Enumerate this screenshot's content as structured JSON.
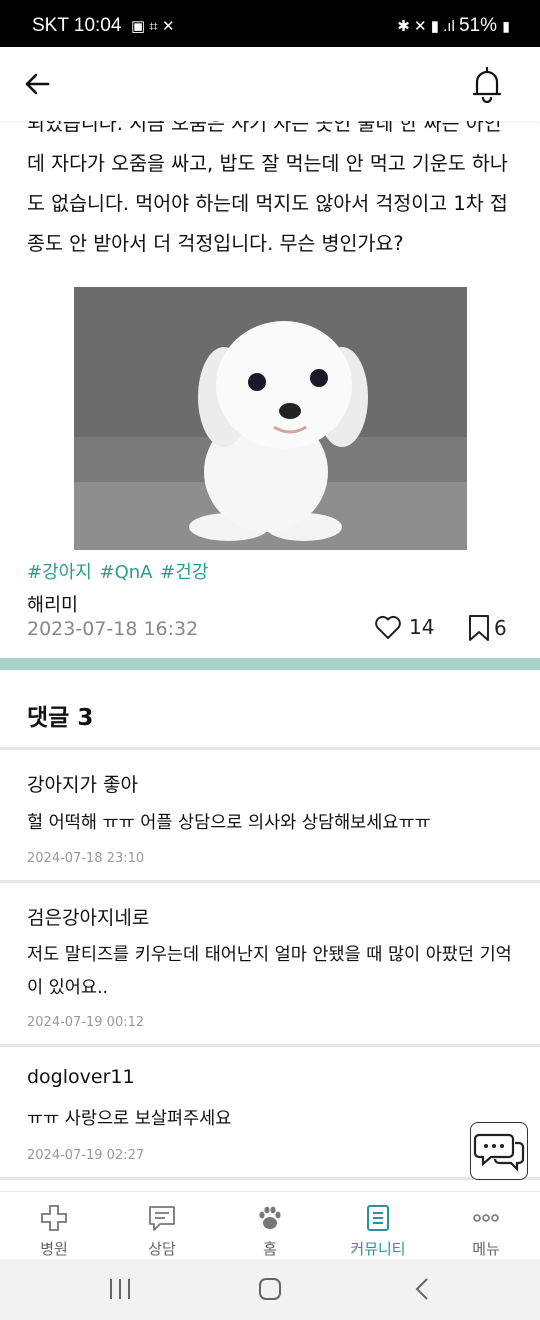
{
  "status_bar": {
    "carrier_time": "SKT 10:04",
    "battery": "51%"
  },
  "post": {
    "body": "되었습니다. 지금 오줌은 자기 자는 곳인 줄네 한 짜는 아인데 자다가 오줌을 싸고, 밥도 잘 먹는데 안 먹고 기운도 하나도 없습니다. 먹어야 하는데 먹지도 않아서 걱정이고 1차 접종도 안 받아서 더 걱정입니다. 무슨 병인가요?",
    "tags": "#강아지 #QnA #건강",
    "author": "해리미",
    "date": "2023-07-18 16:32",
    "likes": "14",
    "bookmarks": "6"
  },
  "comments_section": {
    "title": "댓글 3"
  },
  "comments": [
    {
      "user": "강아지가 좋아",
      "text": "헐 어떡해 ㅠㅠ 어플 상담으로 의사와 상담해보세요ㅠㅠ",
      "date": "2024-07-18 23:10"
    },
    {
      "user": "검은강아지네로",
      "text": "저도 말티즈를 키우는데 태어난지 얼마 안됐을 때 많이 아팠던 기억이 있어요..",
      "date": "2024-07-19 00:12"
    },
    {
      "user": "doglover11",
      "text": "ㅠㅠ 사랑으로 보살펴주세요",
      "date": "2024-07-19 02:27"
    }
  ],
  "bottom_nav": [
    {
      "label": "병원",
      "icon": "hospital-cross-icon"
    },
    {
      "label": "상담",
      "icon": "chat-icon"
    },
    {
      "label": "홈",
      "icon": "paw-icon"
    },
    {
      "label": "커뮤니티",
      "icon": "document-icon",
      "active": true
    },
    {
      "label": "메뉴",
      "icon": "more-icon"
    }
  ],
  "colors": {
    "accent": "#2e9c8c",
    "divider": "#a8d4c8",
    "active_nav": "#2e8fa0"
  }
}
